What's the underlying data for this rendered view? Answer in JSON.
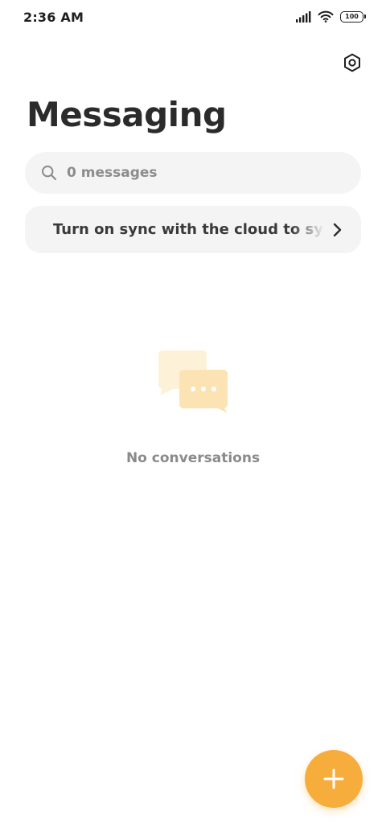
{
  "status_bar": {
    "time": "2:36 AM",
    "battery": "100",
    "icons": [
      "signal-icon",
      "wifi-icon",
      "battery-icon"
    ]
  },
  "header": {
    "title": "Messaging",
    "settings_icon": "settings-hexagon-icon"
  },
  "search": {
    "placeholder": "0 messages",
    "icon": "search-icon"
  },
  "sync_banner": {
    "text": "Turn on sync with the cloud to sync",
    "icon": "chevron-right-icon"
  },
  "empty_state": {
    "icon": "chat-bubbles-icon",
    "text": "No conversations"
  },
  "fab": {
    "icon": "plus-icon"
  },
  "colors": {
    "accent": "#f6ad3c",
    "surface": "#f4f4f4",
    "illustration_light": "#fdf1d8",
    "illustration_mid": "#fbe3b4"
  }
}
